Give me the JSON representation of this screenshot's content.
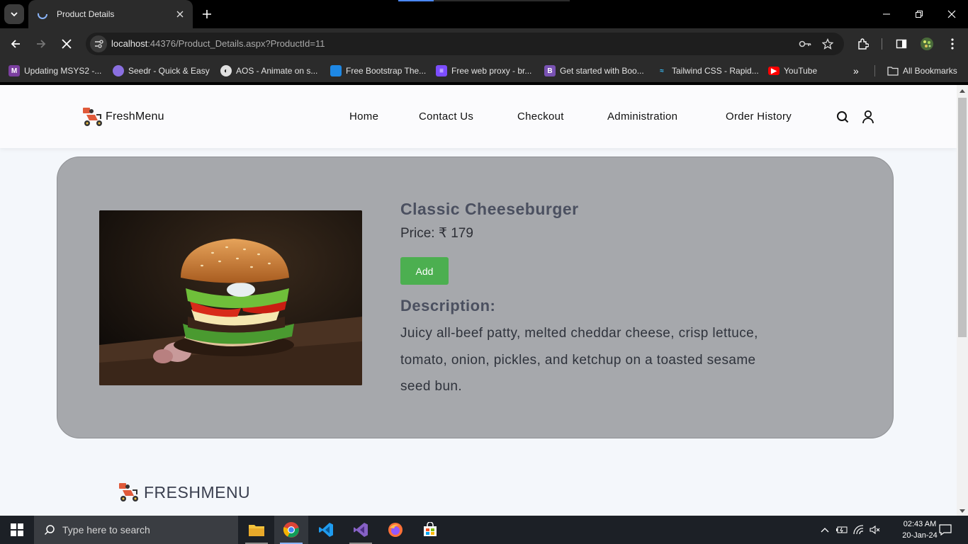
{
  "browser": {
    "tab_title": "Product Details",
    "url_host": "localhost",
    "url_rest": ":44376/Product_Details.aspx?ProductId=11",
    "bookmarks": [
      {
        "label": "Updating MSYS2 -...",
        "icon": "msys2-icon",
        "color": "#7b3fa0"
      },
      {
        "label": "Seedr - Quick & Easy",
        "icon": "seedr-icon",
        "color": "#8a6fe0"
      },
      {
        "label": "AOS - Animate on s...",
        "icon": "globe-icon",
        "color": "#e0e0e0"
      },
      {
        "label": "Free Bootstrap The...",
        "icon": "bootstrap-theme-icon",
        "color": "#1e88e5"
      },
      {
        "label": "Free web proxy - br...",
        "icon": "proxy-icon",
        "color": "#7c4dff"
      },
      {
        "label": "Get started with Boo...",
        "icon": "bootstrap-icon",
        "color": "#7952b3"
      },
      {
        "label": "Tailwind CSS - Rapid...",
        "icon": "tailwind-icon",
        "color": "#38bdf8"
      },
      {
        "label": "YouTube",
        "icon": "youtube-icon",
        "color": "#ff0000"
      }
    ],
    "all_bookmarks": "All Bookmarks"
  },
  "site": {
    "brand": "FreshMenu",
    "nav": [
      "Home",
      "Contact Us",
      "Checkout",
      "Administration",
      "Order History"
    ]
  },
  "product": {
    "title": "Classic Cheeseburger",
    "price": "Price: ₹ 179",
    "add_label": "Add",
    "description_heading": "Description:",
    "description": "Juicy all-beef patty, melted cheddar cheese, crisp lettuce, tomato, onion, pickles, and ketchup on a toasted sesame seed bun."
  },
  "footer": {
    "brand": "FRESHMENU"
  },
  "taskbar": {
    "search_placeholder": "Type here to search",
    "time": "02:43 AM",
    "date": "20-Jan-24"
  },
  "colors": {
    "accent_green": "#4caf50",
    "card_gray": "#a6a8ac"
  }
}
